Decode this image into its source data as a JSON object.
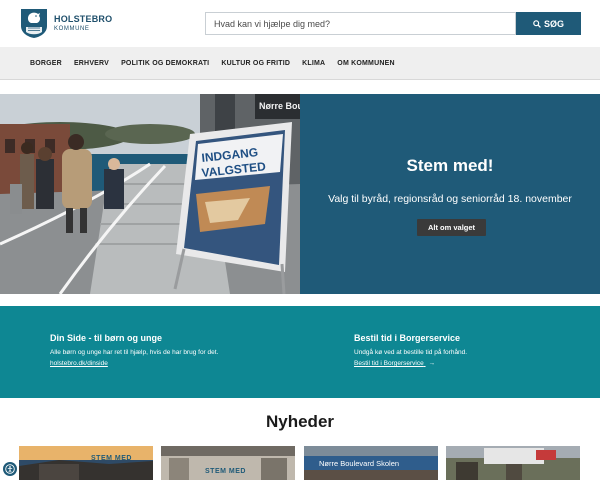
{
  "header": {
    "logo_name": "HOLSTEBRO",
    "logo_sub": "KOMMUNE",
    "search_placeholder": "Hvad kan vi hjælpe dig med?",
    "search_button": "SØG"
  },
  "nav": {
    "items": [
      "BORGER",
      "ERHVERV",
      "POLITIK OG DEMOKRATI",
      "KULTUR OG FRITID",
      "KLIMA",
      "OM KOMMUNEN"
    ]
  },
  "hero": {
    "sign_line1": "INDGANG",
    "sign_line2": "VALGSTED",
    "building_sign": "Nørre Boule",
    "title": "Stem med!",
    "subtitle": "Valg til byråd, regionsråd og seniorråd 18. november",
    "button": "Alt om valget"
  },
  "band": {
    "left": {
      "title": "Din Side - til børn og unge",
      "text": "Alle børn og unge har ret til hjælp, hvis de har brug for det.",
      "link": "holstebro.dk/dinside"
    },
    "right": {
      "title": "Bestil tid i Borgerservice",
      "text": "Undgå kø ved at bestille tid på forhånd.",
      "link": "Bestil tid i Borgerservice",
      "link_arrow": "→"
    }
  },
  "news": {
    "title": "Nyheder",
    "card1_badge": "STEM MED",
    "card2_badge": "STEM MED",
    "card3_sign": "Nørre Boulevard Skolen"
  },
  "colors": {
    "brand": "#1f5a78",
    "teal_band": "#0e8793",
    "nav_bg": "#efefef",
    "hero_button": "#3a3a3a"
  },
  "icons": [
    "holstebro-crest-icon",
    "search-icon",
    "arrow-right-icon",
    "accessibility-icon"
  ]
}
